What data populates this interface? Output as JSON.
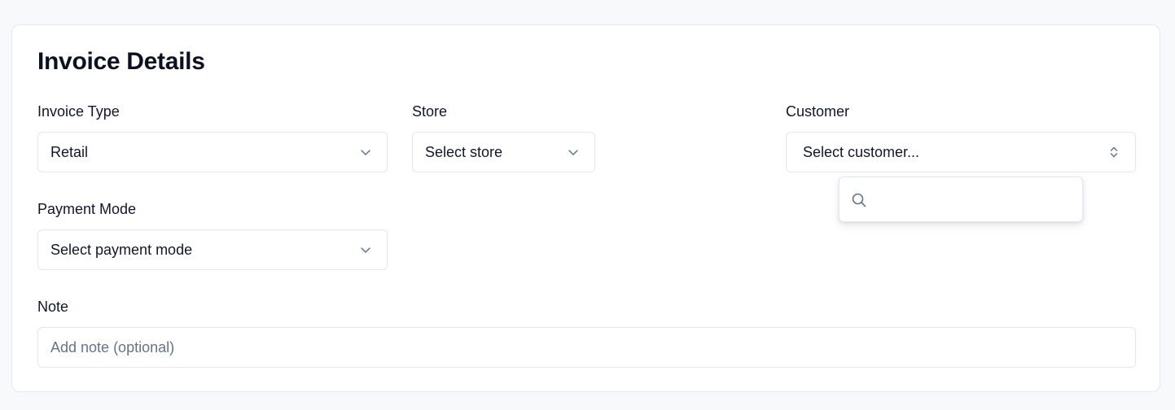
{
  "card": {
    "title": "Invoice Details"
  },
  "fields": {
    "invoice_type": {
      "label": "Invoice Type",
      "value": "Retail"
    },
    "store": {
      "label": "Store",
      "value": "Select store"
    },
    "customer": {
      "label": "Customer",
      "value": "Select customer..."
    },
    "payment_mode": {
      "label": "Payment Mode",
      "value": "Select payment mode"
    },
    "note": {
      "label": "Note",
      "placeholder": "Add note (optional)"
    }
  },
  "customer_popover": {
    "search_placeholder": ""
  },
  "icons": {
    "select": "chevron-down-icon",
    "combobox": "chevrons-up-down-icon",
    "search": "search-icon"
  },
  "colors": {
    "border": "#e2e8f0",
    "text": "#0f172a",
    "placeholder": "#64748b",
    "page_bg": "#f8f9fb"
  }
}
